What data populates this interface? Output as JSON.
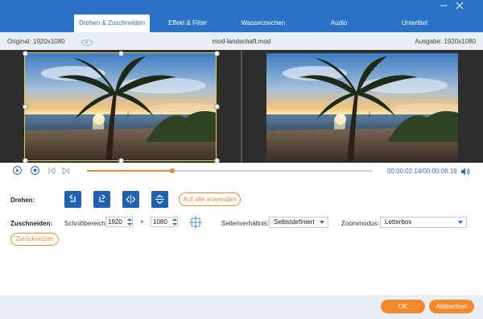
{
  "tabs": [
    {
      "label": "Drehen & Zuschneiden",
      "active": true
    },
    {
      "label": "Effekt & Filter",
      "active": false
    },
    {
      "label": "Wasserzeichen",
      "active": false
    },
    {
      "label": "Audio",
      "active": false
    },
    {
      "label": "Untertitel",
      "active": false
    }
  ],
  "window": {
    "minimize_icon": "minimize-icon",
    "close_icon": "close-icon"
  },
  "infobar": {
    "original": "Original: 1920x1080",
    "filename": "mod-landschaft.mod",
    "output": "Ausgabe: 1920x1080"
  },
  "playback": {
    "time": "00:00:02.14/00:00:08.16",
    "progress": 0.3
  },
  "rotate": {
    "label": "Drehen:",
    "buttons": [
      "rotate-left-icon",
      "rotate-right-icon",
      "flip-horizontal-icon",
      "flip-vertical-icon"
    ],
    "apply_all": "Auf alle anwenden"
  },
  "crop": {
    "label": "Zuschneiden:",
    "area_label": "Schnittbereich:",
    "width": "1920",
    "times": "×",
    "height": "1080",
    "aspect_label": "Seitenverhältnis:",
    "aspect_value": "Selbstdefiniert",
    "zoom_label": "Zoommodus:",
    "zoom_value": "Letterbox",
    "reset": "Zurücksetzen"
  },
  "footer": {
    "ok": "OK",
    "cancel": "Abbrechen"
  },
  "colors": {
    "brand_blue": "#2a73c9",
    "accent_orange": "#f28a2c",
    "video_bg": "#2d2d2d"
  }
}
